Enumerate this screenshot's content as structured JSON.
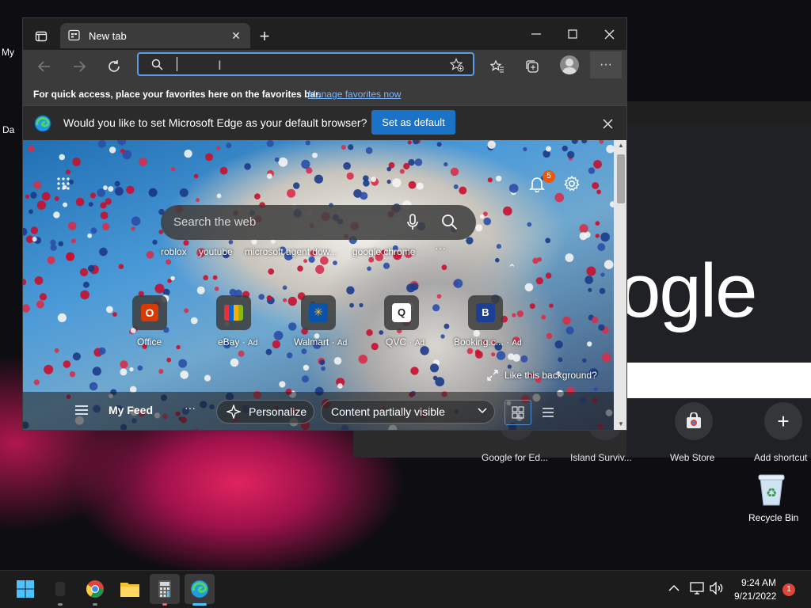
{
  "desktop": {
    "left_fragment_1": "My",
    "left_fragment_2": "Da",
    "recycle_bin_label": "Recycle Bin"
  },
  "background_window": {
    "logo_text": "ogle",
    "shortcuts": [
      {
        "label": "Google for Ed..."
      },
      {
        "label": "Island Surviv..."
      },
      {
        "label": "Web Store"
      },
      {
        "label": "Add shortcut"
      }
    ]
  },
  "edge": {
    "tab_title": "New tab",
    "address_value": "",
    "favbar_text": "For quick access, place your favorites here on the favorites bar.",
    "favbar_link": "Manage favorites now",
    "infobar_text": "Would you like to set Microsoft Edge as your default browser?",
    "set_default_label": "Set as default",
    "ntp": {
      "notification_count": "5",
      "search_placeholder": "Search the web",
      "suggestions": [
        "roblox",
        "youtube",
        "microsoft agent dow...",
        "google chrome"
      ],
      "quick_links": [
        {
          "label": "Office",
          "ad": "",
          "color": "#d83b01",
          "glyph": "O"
        },
        {
          "label": "eBay",
          "ad": "Ad",
          "color": "#2a5fd6",
          "glyph": "e"
        },
        {
          "label": "Walmart",
          "ad": "Ad",
          "color": "#0b53a8",
          "glyph": "✳"
        },
        {
          "label": "QVC",
          "ad": "Ad",
          "color": "#ffffff",
          "glyph": "Q"
        },
        {
          "label": "Booking.c...",
          "ad": "Ad",
          "color": "#1b3f95",
          "glyph": "B"
        }
      ],
      "like_background": "Like this background?",
      "feed_title": "My Feed",
      "personalize_label": "Personalize",
      "content_visibility": "Content partially visible"
    }
  },
  "taskbar": {
    "time": "9:24 AM",
    "date": "9/21/2022",
    "notification_count": "1"
  },
  "colors": {
    "accent": "#1a73c7",
    "focus_border": "#5b9ce8",
    "link": "#7ab7ff",
    "badge": "#e8590c"
  }
}
